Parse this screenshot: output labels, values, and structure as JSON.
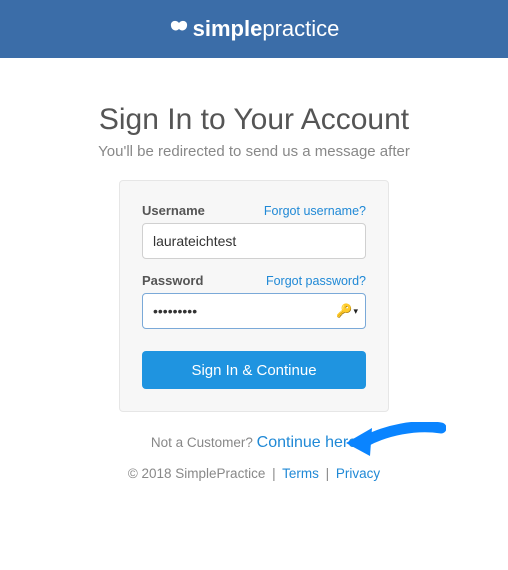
{
  "brand": {
    "name_prefix": "simple",
    "name_suffix": "practice"
  },
  "heading": "Sign In to Your Account",
  "subheading": "You'll be redirected to send us a message after",
  "form": {
    "username_label": "Username",
    "forgot_username": "Forgot username?",
    "username_value": "laurateichtest",
    "password_label": "Password",
    "forgot_password": "Forgot password?",
    "password_value": "•••••••••",
    "submit": "Sign In & Continue"
  },
  "not_customer_text": "Not a Customer? ",
  "continue_here": "Continue here",
  "footer": {
    "copyright": "© 2018 SimplePractice",
    "terms": "Terms",
    "privacy": "Privacy"
  },
  "colors": {
    "banner": "#3b6da8",
    "link": "#2089d6",
    "button": "#1f94e0",
    "arrow": "#0a84ff"
  }
}
